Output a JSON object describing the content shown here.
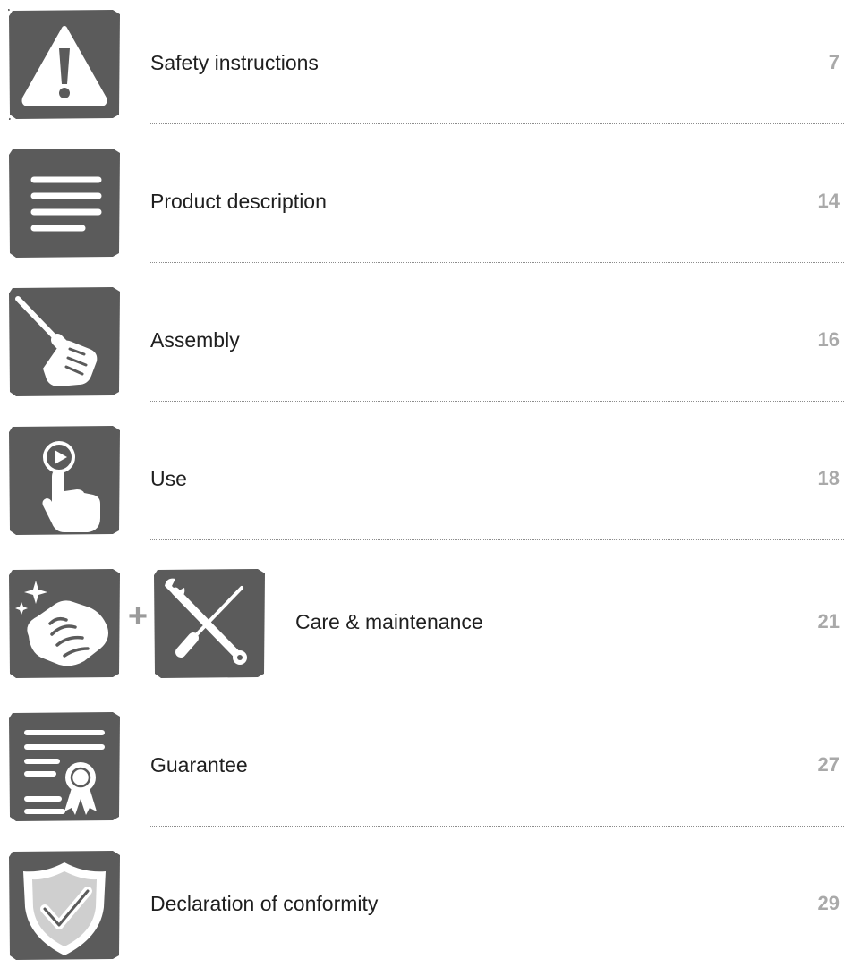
{
  "toc": {
    "entries": [
      {
        "title": "Safety instructions",
        "page": "7",
        "icon": "warning-icon"
      },
      {
        "title": "Product description",
        "page": "14",
        "icon": "text-lines-icon"
      },
      {
        "title": "Assembly",
        "page": "16",
        "icon": "screwdriver-hand-icon"
      },
      {
        "title": "Use",
        "page": "18",
        "icon": "touch-play-icon"
      },
      {
        "title": "Care & maintenance",
        "page": "21",
        "icon": "cleaning-hand-icon",
        "icon_secondary": "wrench-screwdriver-icon",
        "joiner": "+"
      },
      {
        "title": "Guarantee",
        "page": "27",
        "icon": "certificate-icon"
      },
      {
        "title": "Declaration of conformity",
        "page": "29",
        "icon": "shield-check-icon"
      }
    ]
  },
  "colors": {
    "tile": "#5b5b5b",
    "text": "#1f1f1f",
    "page_number": "#a9a9a9",
    "rule": "#8c8c8c",
    "plus": "#9a9a9a"
  }
}
